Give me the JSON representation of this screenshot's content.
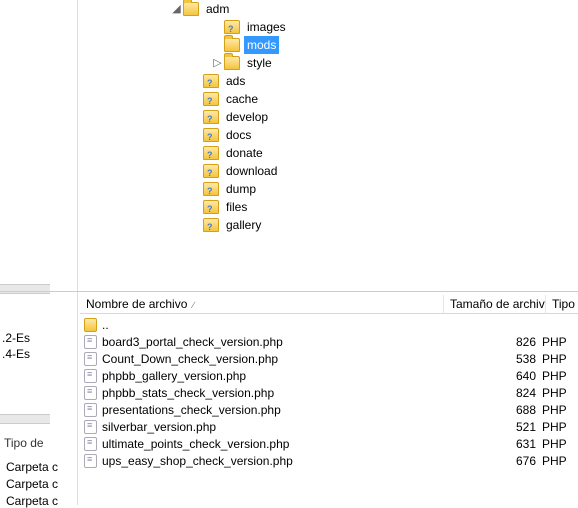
{
  "tree": {
    "root": {
      "label": "adm",
      "type": "open",
      "indent": 90
    },
    "children": [
      {
        "label": "images",
        "type": "q",
        "indent": 131
      },
      {
        "label": "mods",
        "type": "open",
        "indent": 131,
        "selected": true
      },
      {
        "label": "style",
        "type": "open",
        "indent": 131,
        "twisty": "▷"
      }
    ],
    "siblings": [
      {
        "label": "ads",
        "type": "q",
        "indent": 110
      },
      {
        "label": "cache",
        "type": "q",
        "indent": 110
      },
      {
        "label": "develop",
        "type": "q",
        "indent": 110
      },
      {
        "label": "docs",
        "type": "q",
        "indent": 110
      },
      {
        "label": "donate",
        "type": "q",
        "indent": 110
      },
      {
        "label": "download",
        "type": "q",
        "indent": 110
      },
      {
        "label": "dump",
        "type": "q",
        "indent": 110
      },
      {
        "label": "files",
        "type": "q",
        "indent": 110
      },
      {
        "label": "gallery",
        "type": "q",
        "indent": 110
      }
    ]
  },
  "left_fragments": {
    "a": ".2-Es",
    "b": ".4-Es",
    "tipo_label": "Tipo de",
    "carpeta": "Carpeta c"
  },
  "file_header": {
    "col_name": "Nombre de archivo",
    "col_size": "Tamaño de archivo",
    "col_type": "Tipo",
    "name_w": 364,
    "size_w": 102,
    "type_w": 30
  },
  "files": [
    {
      "name": "..",
      "size": "",
      "type": "",
      "icon": "dir"
    },
    {
      "name": "board3_portal_check_version.php",
      "size": "826",
      "type": "PHP",
      "icon": "php"
    },
    {
      "name": "Count_Down_check_version.php",
      "size": "538",
      "type": "PHP",
      "icon": "php"
    },
    {
      "name": "phpbb_gallery_version.php",
      "size": "640",
      "type": "PHP",
      "icon": "php"
    },
    {
      "name": "phpbb_stats_check_version.php",
      "size": "824",
      "type": "PHP",
      "icon": "php"
    },
    {
      "name": "presentations_check_version.php",
      "size": "688",
      "type": "PHP",
      "icon": "php"
    },
    {
      "name": "silverbar_version.php",
      "size": "521",
      "type": "PHP",
      "icon": "php"
    },
    {
      "name": "ultimate_points_check_version.php",
      "size": "631",
      "type": "PHP",
      "icon": "php"
    },
    {
      "name": "ups_easy_shop_check_version.php",
      "size": "676",
      "type": "PHP",
      "icon": "php"
    }
  ]
}
